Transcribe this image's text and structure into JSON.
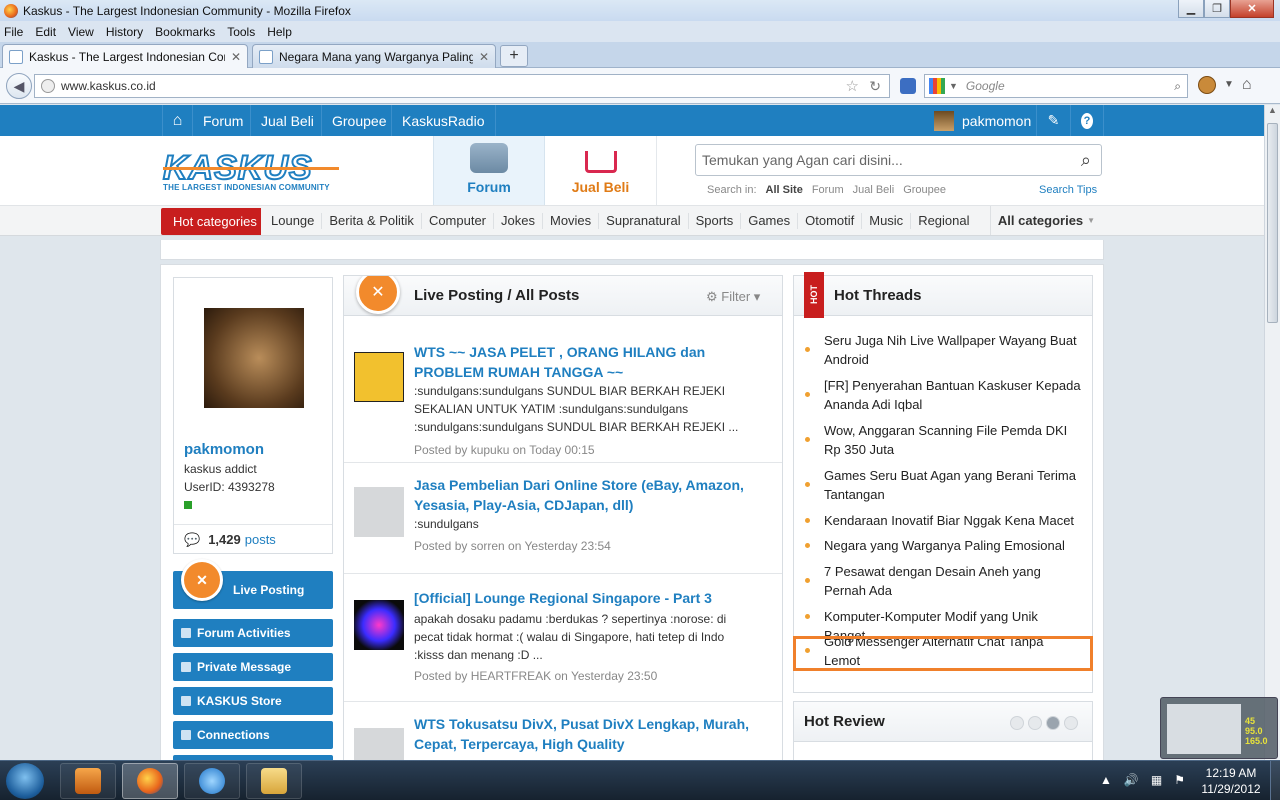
{
  "window": {
    "title": "Kaskus - The Largest Indonesian Community - Mozilla Firefox"
  },
  "menubar": [
    "File",
    "Edit",
    "View",
    "History",
    "Bookmarks",
    "Tools",
    "Help"
  ],
  "tabs": [
    {
      "label": "Kaskus - The Largest Indonesian Com...",
      "active": true
    },
    {
      "label": "Negara Mana yang Warganya Paling ...",
      "active": false
    }
  ],
  "nav": {
    "url": "www.kaskus.co.id",
    "search_placeholder": "Google"
  },
  "kaskus": {
    "topnav": [
      "Forum",
      "Jual Beli",
      "Groupee",
      "KaskusRadio"
    ],
    "username": "pakmomon",
    "logo_word": "KASKUS",
    "logo_sub": "THE LARGEST INDONESIAN COMMUNITY",
    "header_tabs": {
      "forum": "Forum",
      "jual_beli": "Jual Beli"
    },
    "search": {
      "placeholder": "Temukan yang Agan cari disini...",
      "in_label": "Search in:",
      "options": [
        "All Site",
        "Forum",
        "Jual Beli",
        "Groupee"
      ],
      "tips": "Search Tips"
    },
    "categories": {
      "hot": "Hot categories",
      "items": [
        "Lounge",
        "Berita & Politik",
        "Computer",
        "Jokes",
        "Movies",
        "Supranatural",
        "Sports",
        "Games",
        "Otomotif",
        "Music",
        "Regional"
      ],
      "all": "All categories"
    },
    "profile": {
      "name": "pakmomon",
      "rank": "kaskus addict",
      "userid": "UserID: 4393278",
      "post_count": "1,429",
      "posts_label": "posts"
    },
    "menu": {
      "live": "Live Posting",
      "items": [
        "Forum Activities",
        "Private Message",
        "KASKUS Store",
        "Connections"
      ]
    },
    "live_panel": {
      "title": "Live Posting / All Posts",
      "filter": "Filter",
      "posts": [
        {
          "title": "WTS ~~ JASA PELET , ORANG HILANG dan PROBLEM RUMAH TANGGA ~~",
          "excerpt": ":sundulgans:sundulgans SUNDUL BIAR BERKAH REJEKI SEKALIAN UNTUK YATIM :sundulgans:sundulgans :sundulgans:sundulgans SUNDUL BIAR BERKAH REJEKI ...",
          "meta": "Posted by kupuku on Today 00:15"
        },
        {
          "title": "Jasa Pembelian Dari Online Store (eBay, Amazon, Yesasia, Play-Asia, CDJapan, dll)",
          "excerpt": ":sundulgans",
          "meta": "Posted by sorren on Yesterday 23:54"
        },
        {
          "title": "[Official] Lounge Regional Singapore - Part 3",
          "excerpt": "apakah dosaku padamu :berdukas ? sepertinya :norose: di pecat tidak hormat :( walau di Singapore, hati tetep di Indo :kisss dan menang :D ...",
          "meta": "Posted by HEARTFREAK on Yesterday 23:50"
        },
        {
          "title": "WTS Tokusatsu DivX, Pusat DivX Lengkap, Murah, Cepat, Terpercaya, High Quality",
          "excerpt": "",
          "meta": ""
        }
      ]
    },
    "hot_threads": {
      "title": "Hot Threads",
      "ribbon": "HOT",
      "items": [
        "Seru Juga Nih Live Wallpaper Wayang Buat Android",
        "[FR] Penyerahan Bantuan Kaskuser Kepada Ananda Adi Iqbal",
        "Wow, Anggaran Scanning File Pemda DKI Rp 350 Juta",
        "Games Seru Buat Agan yang Berani Terima Tantangan",
        "Kendaraan Inovatif Biar Nggak Kena Macet",
        "Negara yang Warganya Paling Emosional",
        "7 Pesawat dengan Desain Aneh yang Pernah Ada",
        "Komputer-Komputer Modif yang Unik Banget",
        "Gold Messenger Alternatif Chat Tanpa Lemot"
      ],
      "highlighted_index": 5
    },
    "hot_review": {
      "title": "Hot Review"
    }
  },
  "gadget": {
    "values": [
      "45",
      "95.0",
      "165.0"
    ]
  },
  "taskbar": {
    "time": "12:19 AM",
    "date": "11/29/2012"
  }
}
